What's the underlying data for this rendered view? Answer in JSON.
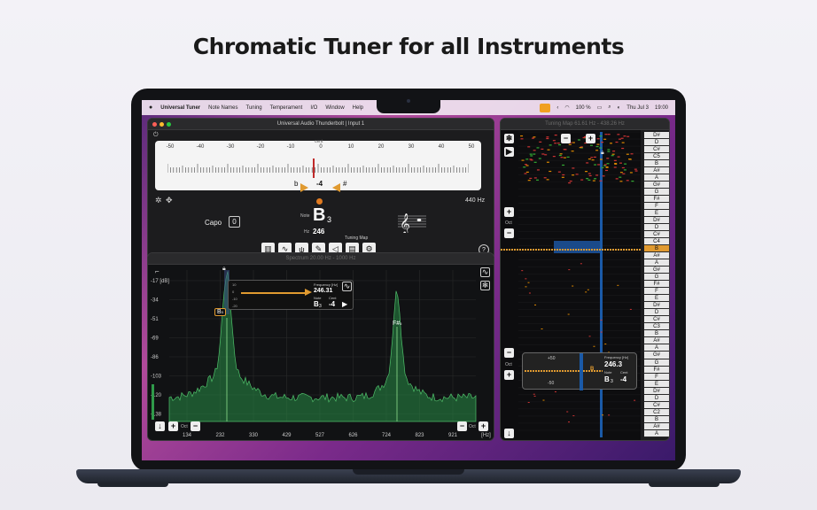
{
  "headline": "Chromatic Tuner for all Instruments",
  "menubar": {
    "apple": "",
    "items": [
      "Universal Tuner",
      "Note Names",
      "Tuning",
      "Temperament",
      "I/O",
      "Window",
      "Help"
    ],
    "battery": "100 %",
    "date": "Thu Jul 3",
    "time": "19:00"
  },
  "tuner": {
    "title": "Universal Audio Thunderbolt | Input 1",
    "scale_labels": [
      "-50",
      "-40",
      "-30",
      "-20",
      "-10",
      "0",
      "10",
      "20",
      "30",
      "40",
      "50"
    ],
    "cent_label": "cent",
    "flat": "b",
    "sharp": "#",
    "cent_value": "-4",
    "capo_label": "Capo",
    "capo_value": "0",
    "note_label": "Note",
    "note": "B",
    "octave": "3",
    "hz_label": "Hz",
    "hz_value": "246",
    "reference": "440 Hz",
    "tuning_map_label": "Tuning Map",
    "help": "?"
  },
  "spectrum": {
    "title": "Spectrum  20.00 Hz - 1000 Hz",
    "db_labels": [
      "-17 [dB]",
      "-34",
      "-51",
      "-69",
      "-86",
      "-103",
      "-120",
      "-138"
    ],
    "freq_labels": [
      "134",
      "232",
      "330",
      "429",
      "527",
      "626",
      "724",
      "823",
      "921",
      "[Hz]"
    ],
    "peak1_label": "B",
    "peak1_oct": "3",
    "peak2_label": "F#",
    "peak2_oct": "5",
    "readout": {
      "scale": [
        "10",
        "0",
        "-10",
        "-20"
      ],
      "freq_label": "Frequency [Hz]",
      "freq": "246.31",
      "note_label": "Note",
      "cent_label": "Cent",
      "note": "B",
      "oct": "3",
      "cent": "-4"
    },
    "oct_label": "Oct"
  },
  "tuning_map": {
    "title": "Tuning Map  61.61 Hz - 438.26 Hz",
    "oct_label": "Oct",
    "notes": [
      "D#",
      "D",
      "C#",
      "C5",
      "B",
      "A#",
      "A",
      "G#",
      "G",
      "F#",
      "F",
      "E",
      "D#",
      "D",
      "C#",
      "C4",
      "B",
      "A#",
      "A",
      "G#",
      "G",
      "F#",
      "F",
      "E",
      "D#",
      "D",
      "C#",
      "C3",
      "B",
      "A#",
      "A",
      "G#",
      "G",
      "F#",
      "F",
      "E",
      "D#",
      "D",
      "C#",
      "C2",
      "B",
      "A#",
      "A"
    ],
    "readout": {
      "plus50": "+50",
      "minus50": "-50",
      "freq_label": "Frequency [Hz]",
      "freq": "246.3",
      "note_label": "Note",
      "cent_label": "Cent",
      "note": "B",
      "oct": "3",
      "cent": "-4",
      "marker": "B"
    }
  },
  "colors": {
    "accent": "#e09a30",
    "spectrum_green": "#2f9a4a",
    "map_blue": "#1a5aa8"
  },
  "icons": [
    "snowflake-icon",
    "play-icon",
    "plus-icon",
    "minus-icon",
    "lock-icon",
    "piano-icon",
    "waveform-icon",
    "tuning-fork-icon",
    "microphone-icon",
    "speaker-icon",
    "map-icon",
    "settings-icon",
    "help-icon",
    "download-icon",
    "treble-clef-icon"
  ]
}
